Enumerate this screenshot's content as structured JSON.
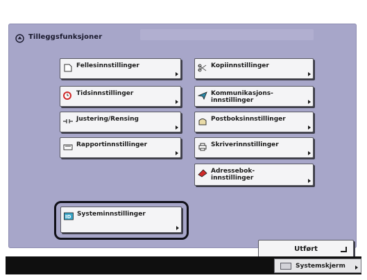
{
  "header": {
    "title": "Tilleggsfunksjoner",
    "title_icon": "additional-functions-icon"
  },
  "menu": {
    "left": [
      {
        "id": "felles",
        "label": "Fellesinnstillinger",
        "icon": "page-icon"
      },
      {
        "id": "tids",
        "label": "Tidsinnstillinger",
        "icon": "clock-icon"
      },
      {
        "id": "justering",
        "label": "Justering/Rensing",
        "icon": "adjust-icon"
      },
      {
        "id": "rapport",
        "label": "Rapportinnstillinger",
        "icon": "report-icon"
      }
    ],
    "right": [
      {
        "id": "kopi",
        "label": "Kopiinnstillinger",
        "icon": "copy-icon"
      },
      {
        "id": "kommunikasjon",
        "label_line1": "Kommunikasjons-",
        "label_line2": "innstillinger",
        "icon": "paper-plane-icon"
      },
      {
        "id": "postboks",
        "label": "Postboksinnstillinger",
        "icon": "mailbox-icon"
      },
      {
        "id": "skriver",
        "label": "Skriverinnstillinger",
        "icon": "printer-icon"
      },
      {
        "id": "adressebok",
        "label_line1": "Adressebok-",
        "label_line2": "innstillinger",
        "icon": "address-book-icon"
      }
    ],
    "system": {
      "label": "Systeminnstillinger",
      "icon": "id-card-icon",
      "selected": true
    }
  },
  "actions": {
    "ok_label": "Utført",
    "ok_icon": "enter-icon"
  },
  "footer": {
    "system_monitor_label": "Systemskjerm",
    "system_monitor_icon": "monitor-icon"
  },
  "colors": {
    "panel": "#a7a6c9",
    "button": "#f4f4f6",
    "bar": "#0f0f0f",
    "clock_red": "#cf2a2a",
    "id_blue": "#3aa6c9"
  }
}
